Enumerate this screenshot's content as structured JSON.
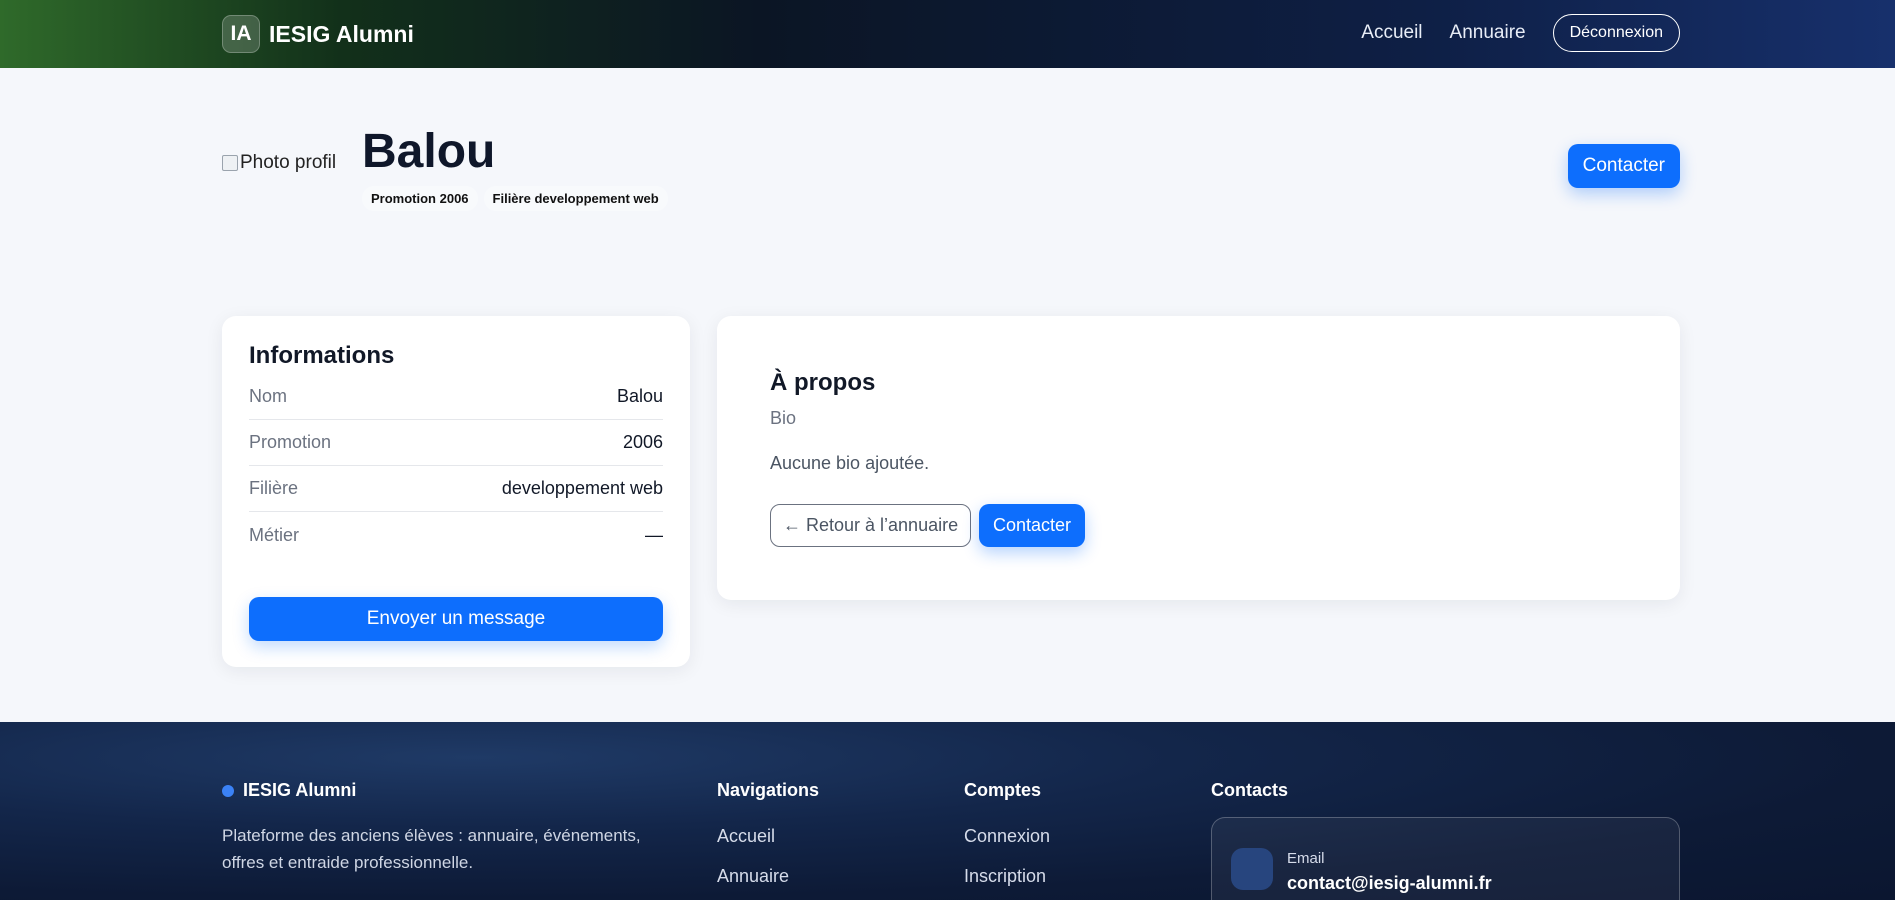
{
  "nav": {
    "logo": "IA",
    "brand": "IESIG Alumni",
    "links": [
      "Accueil",
      "Annuaire"
    ],
    "logout": "Déconnexion"
  },
  "profile": {
    "photo_alt": "Photo profil",
    "name": "Balou",
    "badges": [
      "Promotion 2006",
      "Filière developpement web"
    ],
    "contact_button": "Contacter"
  },
  "info": {
    "title": "Informations",
    "rows": [
      {
        "label": "Nom",
        "value": "Balou"
      },
      {
        "label": "Promotion",
        "value": "2006"
      },
      {
        "label": "Filière",
        "value": "developpement web"
      },
      {
        "label": "Métier",
        "value": "—"
      }
    ],
    "message_button": "Envoyer un message"
  },
  "about": {
    "title": "À propos",
    "subtitle": "Bio",
    "text": "Aucune bio ajoutée.",
    "back_button": "← Retour à l’annuaire",
    "contact_button": "Contacter"
  },
  "footer": {
    "brand": "IESIG Alumni",
    "description": "Plateforme des anciens élèves : annuaire, événements, offres et entraide professionnelle.",
    "nav_title": "Navigations",
    "nav_links": [
      "Accueil",
      "Annuaire"
    ],
    "accounts_title": "Comptes",
    "accounts_links": [
      "Connexion",
      "Inscription"
    ],
    "contacts_title": "Contacts",
    "email_label": "Email",
    "email_value": "contact@iesig-alumni.fr"
  },
  "colors": {
    "primary": "#0d6efd",
    "footer_bg": "#0d1a36"
  }
}
